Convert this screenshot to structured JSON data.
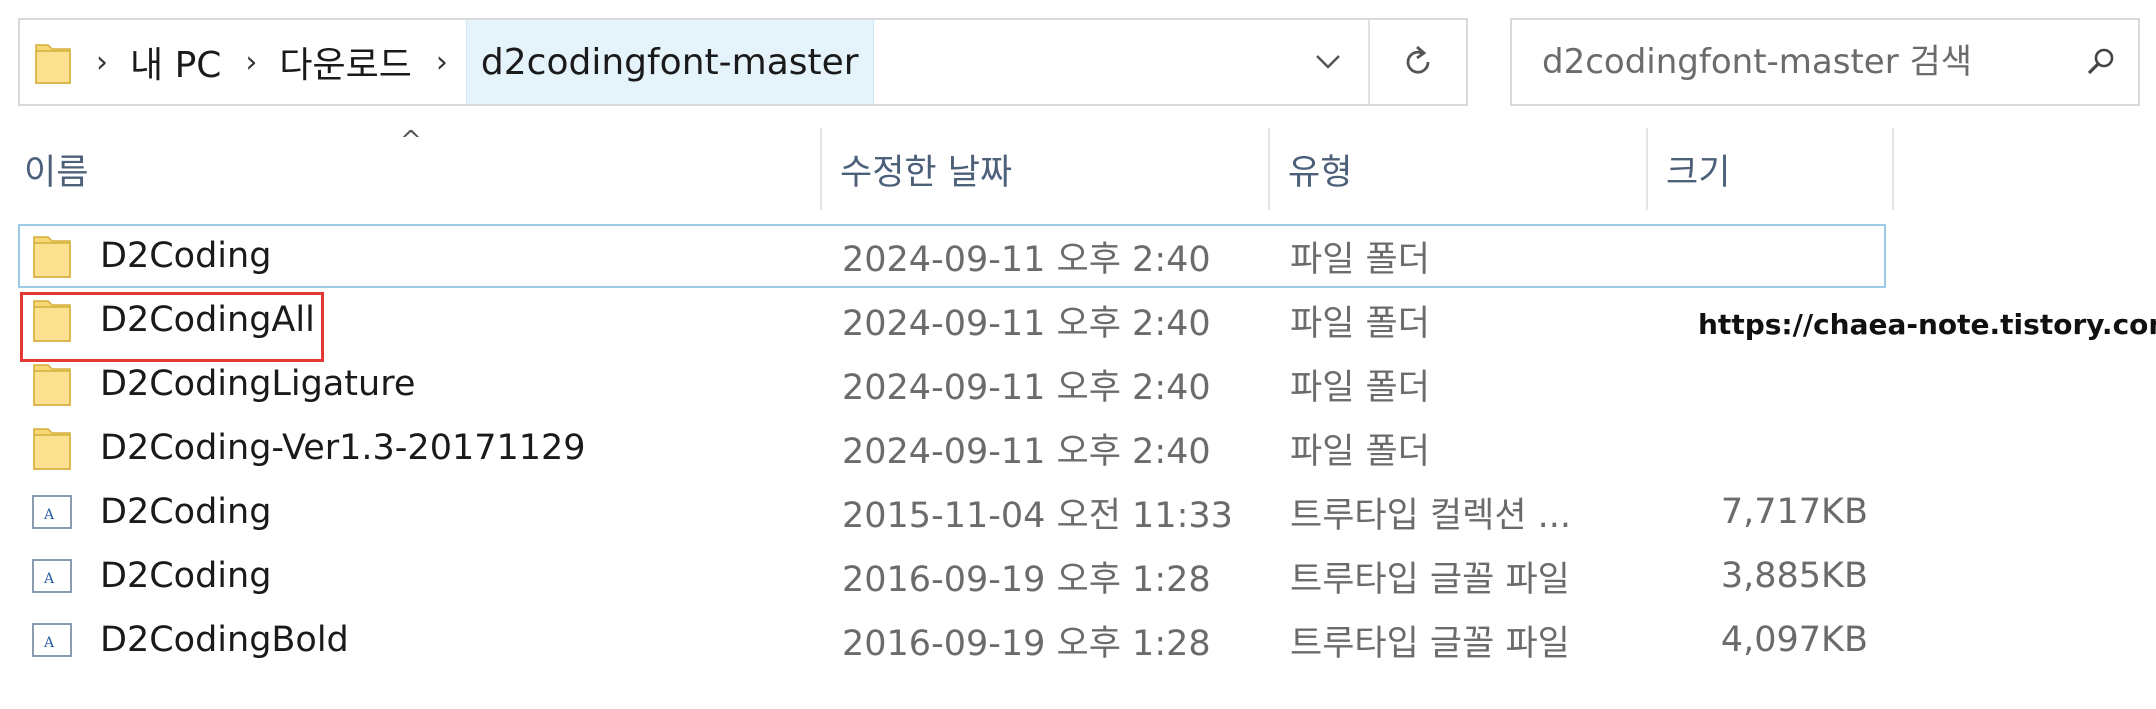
{
  "address_bar": {
    "crumbs": [
      "내 PC",
      "다운로드",
      "d2codingfont-master"
    ],
    "separator": "›"
  },
  "search": {
    "placeholder": "d2codingfont-master 검색"
  },
  "columns": {
    "name": "이름",
    "date": "수정한 날짜",
    "type": "유형",
    "size": "크기",
    "sort_indicator": "^"
  },
  "rows": [
    {
      "name": "D2Coding",
      "date": "2024-09-11 오후 2:40",
      "type": "파일 폴더",
      "size": "",
      "icon": "folder-icon"
    },
    {
      "name": "D2CodingAll",
      "date": "2024-09-11 오후 2:40",
      "type": "파일 폴더",
      "size": "",
      "icon": "folder-icon"
    },
    {
      "name": "D2CodingLigature",
      "date": "2024-09-11 오후 2:40",
      "type": "파일 폴더",
      "size": "",
      "icon": "folder-icon"
    },
    {
      "name": "D2Coding-Ver1.3-20171129",
      "date": "2024-09-11 오후 2:40",
      "type": "파일 폴더",
      "size": "",
      "icon": "folder-icon"
    },
    {
      "name": "D2Coding",
      "date": "2015-11-04 오전 11:33",
      "type": "트루타입 컬렉션 ...",
      "size": "7,717KB",
      "icon": "font-file-icon"
    },
    {
      "name": "D2Coding",
      "date": "2016-09-19 오후 1:28",
      "type": "트루타입 글꼴 파일",
      "size": "3,885KB",
      "icon": "font-file-icon"
    },
    {
      "name": "D2CodingBold",
      "date": "2016-09-19 오후 1:28",
      "type": "트루타입 글꼴 파일",
      "size": "4,097KB",
      "icon": "font-file-icon"
    }
  ],
  "watermark": "https://chaea-note.tistory.com/",
  "colors": {
    "folder_yellow": "#f8d775",
    "selection_blue": "#e5f3fb",
    "highlight_red": "#e53935",
    "header_text": "#4c607a"
  }
}
